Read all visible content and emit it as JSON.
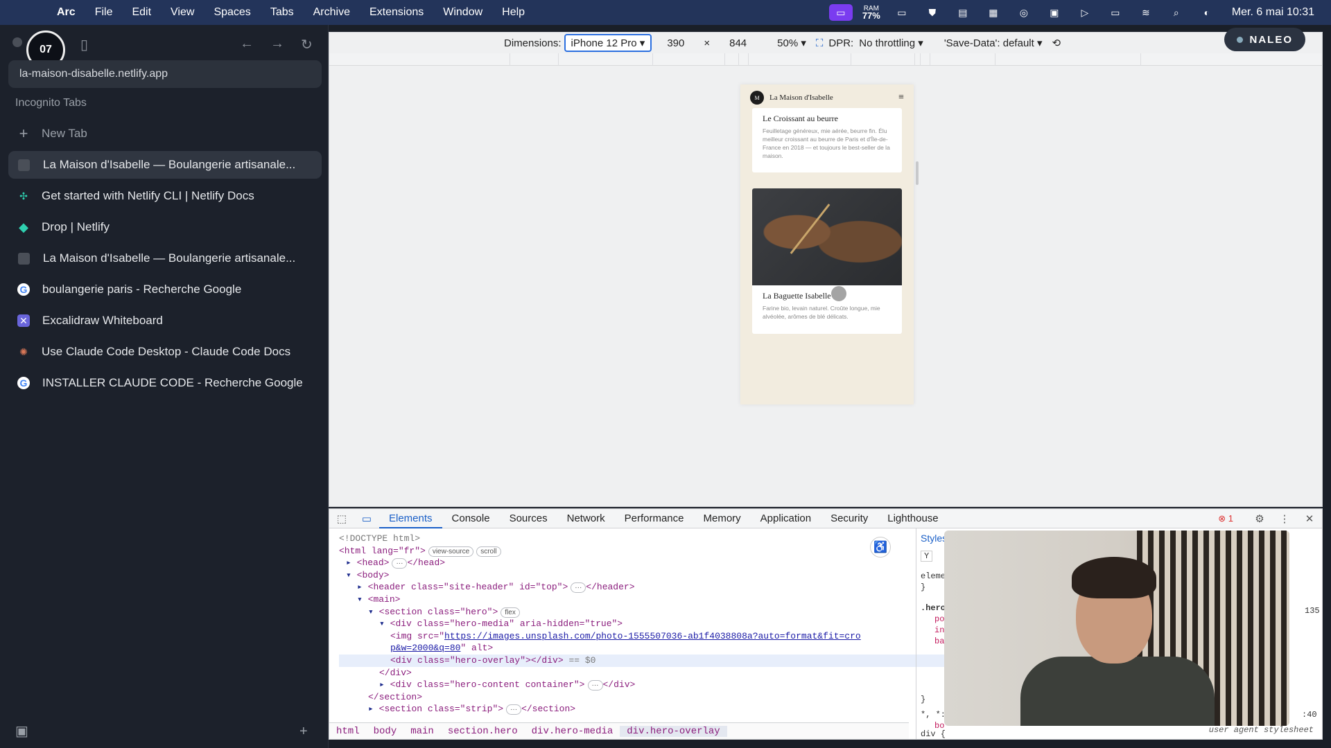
{
  "menubar": {
    "apple": "",
    "items": [
      "Arc",
      "File",
      "Edit",
      "View",
      "Spaces",
      "Tabs",
      "Archive",
      "Extensions",
      "Window",
      "Help"
    ],
    "ram_label": "RAM",
    "ram_value": "77%",
    "clock": "Mer. 6 mai 10:31"
  },
  "sidebar": {
    "timer": "07",
    "url": "la-maison-disabelle.netlify.app",
    "section_label": "Incognito Tabs",
    "new_tab": "New Tab",
    "tabs": [
      {
        "label": "La Maison d'Isabelle — Boulangerie artisanale...",
        "icon": "gray-square-icon"
      },
      {
        "label": "Get started with Netlify CLI | Netlify Docs",
        "icon": "netlify-icon"
      },
      {
        "label": "Drop | Netlify",
        "icon": "netlify-drop-icon"
      },
      {
        "label": "La Maison d'Isabelle — Boulangerie artisanale...",
        "icon": "gray-square-icon"
      },
      {
        "label": "boulangerie paris - Recherche Google",
        "icon": "google-icon"
      },
      {
        "label": "Excalidraw Whiteboard",
        "icon": "excalidraw-icon"
      },
      {
        "label": "Use Claude Code Desktop - Claude Code Docs",
        "icon": "claude-icon"
      },
      {
        "label": "INSTALLER CLAUDE CODE - Recherche Google",
        "icon": "google-icon"
      }
    ]
  },
  "devicebar": {
    "dimensions_label": "Dimensions:",
    "device": "iPhone 12 Pro",
    "width": "390",
    "times": "×",
    "height": "844",
    "zoom": "50%",
    "dpr_label": "DPR:",
    "throttle": "No throttling",
    "save_data": "'Save-Data': default",
    "badge": "NALEO"
  },
  "phone": {
    "logo": "M",
    "site_name": "La Maison d'Isabelle",
    "card1_title": "Le Croissant au beurre",
    "card1_text": "Feuilletage généreux, mie aérée, beurre fin. Élu meilleur croissant au beurre de Paris et d'Île-de-France en 2018 — et toujours le best-seller de la maison.",
    "card2_title": "La Baguette Isabelle",
    "card2_text": "Farine bio, levain naturel. Croûte longue, mie alvéolée, arômes de blé délicats."
  },
  "devtools": {
    "tabs": [
      "Elements",
      "Console",
      "Sources",
      "Network",
      "Performance",
      "Memory",
      "Application",
      "Security",
      "Lighthouse"
    ],
    "error_count": "1",
    "dom": {
      "doctype": "<!DOCTYPE html>",
      "html_open": "<html lang=\"fr\">",
      "pill_view_source": "view-source",
      "pill_scroll": "scroll",
      "head": "<head>",
      "head_close": "</head>",
      "ellipsis": "···",
      "body": "<body>",
      "header": "<header class=\"site-header\" id=\"top\">",
      "header_close": "</header>",
      "main": "<main>",
      "section_hero": "<section class=\"hero\">",
      "pill_flex": "flex",
      "hero_media": "<div class=\"hero-media\" aria-hidden=\"true\">",
      "img_open": "<img src=\"",
      "img_src": "https://images.unsplash.com/photo-1555507036-ab1f4038808a?auto=format&fit=crop&w=2000&q=80",
      "img_close": "\" alt>",
      "hero_overlay": "<div class=\"hero-overlay\"></div>",
      "eq0": "== $0",
      "div_close": "</div>",
      "hero_content": "<div class=\"hero-content container\">",
      "section_close": "</section>",
      "section_strip": "<section class=\"strip\">"
    },
    "breadcrumbs": [
      "html",
      "body",
      "main",
      "section.hero",
      "div.hero-media",
      "div.hero-overlay"
    ],
    "styles": {
      "tab": "Styles",
      "element": "eleme",
      "brace_close": "}",
      "hero_sel": ".hero",
      "po": "po",
      "in": "in",
      "ba": "ba",
      "star_sel": "*, *:",
      "bo": "bo",
      "div_sel": "div {",
      "ln135": "135",
      "ln40": ":40",
      "user_agent": "user agent stylesheet"
    }
  }
}
